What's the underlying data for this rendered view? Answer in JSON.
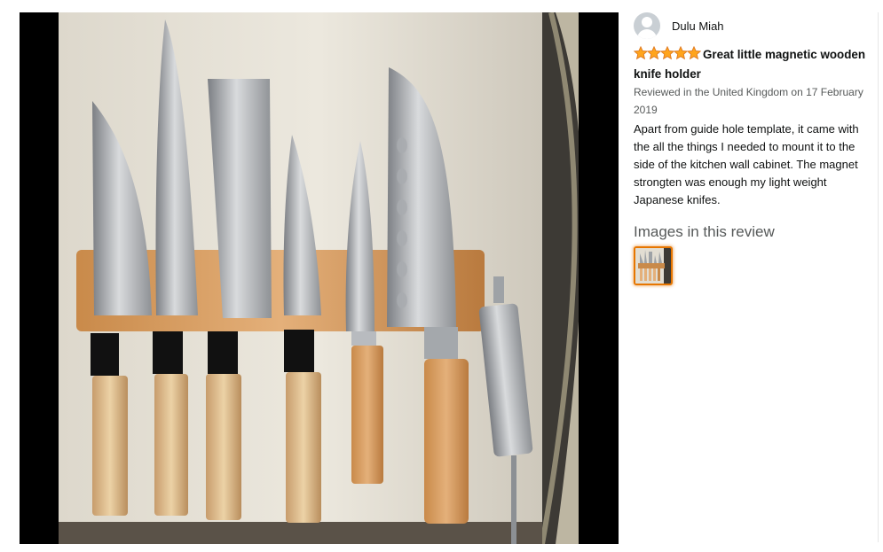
{
  "review": {
    "profile_name": "Dulu Miah",
    "rating": 5,
    "rating_max": 5,
    "title": "Great little magnetic wooden knife holder",
    "meta": "Reviewed in the United Kingdom on 17 February 2019",
    "body": "Apart from guide hole template, it came with the all the things I needed to mount it to the side of the kitchen wall cabinet. The magnet strongten was enough my light weight Japanese knifes."
  },
  "images_section": {
    "heading": "Images in this review",
    "thumbnail_count": 1
  },
  "colors": {
    "star": "#ffa41c",
    "star_outline": "#de7921",
    "thumb_border": "#e77600",
    "meta_text": "#565959"
  },
  "icons": {
    "avatar": "default-user-icon",
    "star": "star-icon"
  }
}
